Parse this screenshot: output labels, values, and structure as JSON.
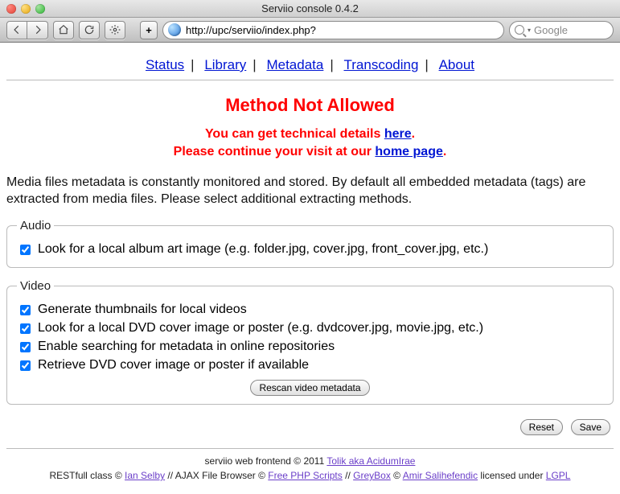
{
  "window": {
    "title": "Serviio console 0.4.2"
  },
  "toolbar": {
    "url": "http://upc/serviio/index.php?",
    "search_placeholder": "Google"
  },
  "nav": {
    "items": [
      "Status",
      "Library",
      "Metadata",
      "Transcoding",
      "About"
    ]
  },
  "error": {
    "heading": "Method Not Allowed",
    "line1_pre": "You can get technical details ",
    "line1_link": "here",
    "line1_post": ".",
    "line2_pre": "Please continue your visit at our ",
    "line2_link": "home page",
    "line2_post": "."
  },
  "intro": "Media files metadata is constantly monitored and stored. By default all embedded metadata (tags) are extracted from media files. Please select additional extracting methods.",
  "audio": {
    "legend": "Audio",
    "opt1": {
      "checked": true,
      "label": "Look for a local album art image (e.g. folder.jpg, cover.jpg, front_cover.jpg, etc.)"
    }
  },
  "video": {
    "legend": "Video",
    "opt1": {
      "checked": true,
      "label": "Generate thumbnails for local videos"
    },
    "opt2": {
      "checked": true,
      "label": "Look for a local DVD cover image or poster (e.g. dvdcover.jpg, movie.jpg, etc.)"
    },
    "opt3": {
      "checked": true,
      "label": "Enable searching for metadata in online repositories"
    },
    "opt4": {
      "checked": true,
      "label": "Retrieve DVD cover image or poster if available"
    },
    "rescan": "Rescan video metadata"
  },
  "actions": {
    "reset": "Reset",
    "save": "Save"
  },
  "footer": {
    "line1_pre": "serviio web frontend © 2011 ",
    "line1_link": "Tolik aka AcidumIrae",
    "l2_a": "RESTfull class © ",
    "l2_a_link": "Ian Selby",
    "l2_b": " // AJAX File Browser © ",
    "l2_b_link": "Free PHP Scripts",
    "l2_c": " // ",
    "l2_c_link": "GreyBox",
    "l2_d": " © ",
    "l2_d_link": "Amir Salihefendic",
    "l2_e": " licensed under ",
    "l2_e_link": "LGPL"
  }
}
